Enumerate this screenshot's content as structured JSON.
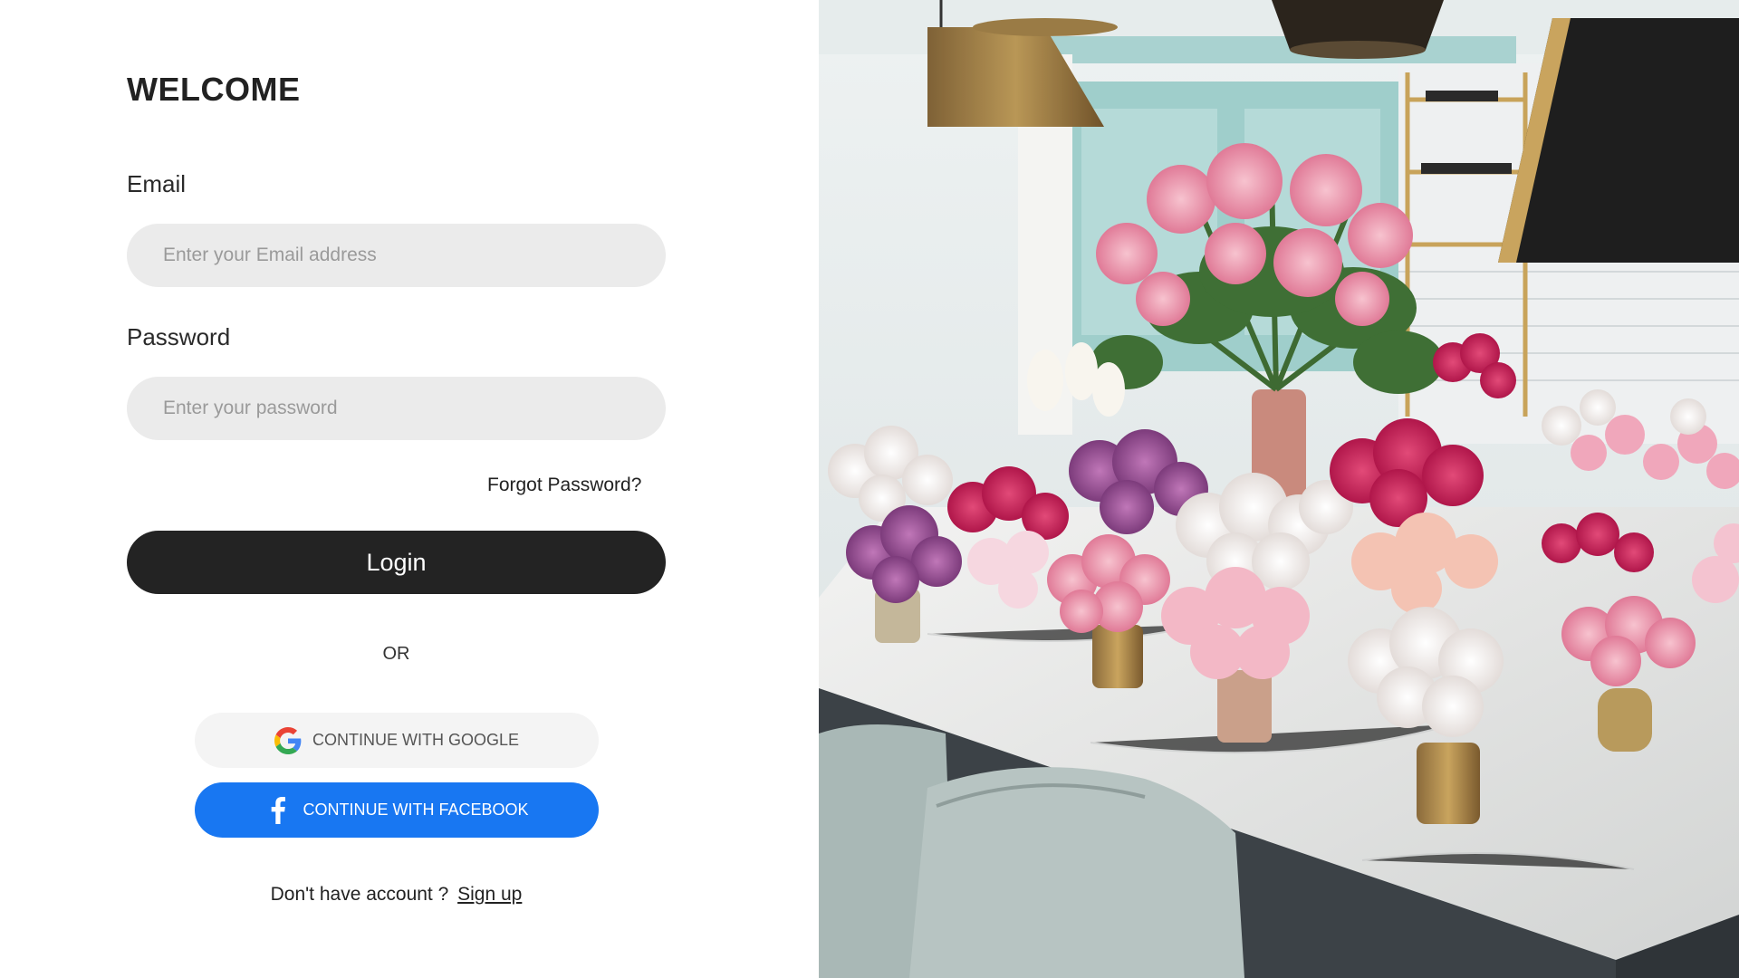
{
  "login": {
    "title": "WELCOME",
    "email_label": "Email",
    "email_placeholder": "Enter your Email address",
    "password_label": "Password",
    "password_placeholder": "Enter your password",
    "forgot_password": "Forgot Password?",
    "login_button": "Login",
    "or_text": "OR",
    "google_button": "CONTINUE WITH GOOGLE",
    "facebook_button": "CONTINUE WITH FACEBOOK",
    "no_account_text": "Don't have account ?",
    "signup_link": "Sign up"
  },
  "icons": {
    "google": "google-icon",
    "facebook": "facebook-icon"
  },
  "colors": {
    "primary_button": "#232323",
    "input_background": "#ebebeb",
    "facebook_blue": "#1877f2",
    "google_button_background": "#f4f4f4"
  }
}
